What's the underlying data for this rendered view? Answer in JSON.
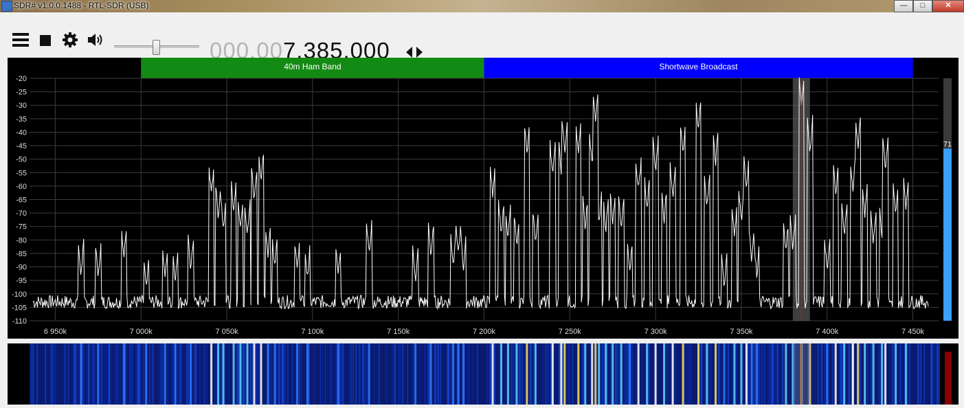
{
  "window": {
    "title": "SDR# v1.0.0.1488 - RTL-SDR (USB)",
    "minimize": "—",
    "maximize": "□",
    "close": "✕"
  },
  "toolbar": {
    "icons": [
      "menu-icon",
      "stop-icon",
      "gear-icon",
      "speaker-icon"
    ],
    "volume_fraction": 0.49,
    "frequency_dim": "000.00",
    "frequency_bright": "7.385.000"
  },
  "colors": {
    "ham_band": "#138a13",
    "broadcast_band": "#0000ff",
    "trace": "#ffffff",
    "vfo": "#ff0000",
    "level_bar": "#3aa0ff"
  },
  "bandplan": [
    {
      "label": "40m Ham Band",
      "start_khz": 7000,
      "end_khz": 7200
    },
    {
      "label": "Shortwave Broadcast",
      "start_khz": 7200,
      "end_khz": 7450
    }
  ],
  "level": {
    "label": "71",
    "value": 71,
    "max": 100
  },
  "chart_data": {
    "type": "line",
    "xlim": [
      6935,
      7465
    ],
    "ylim": [
      -110,
      -20
    ],
    "x_ticks": [
      6950,
      7000,
      7050,
      7100,
      7150,
      7200,
      7250,
      7300,
      7350,
      7400,
      7450
    ],
    "x_tick_labels": [
      "6 950k",
      "7 000k",
      "7 050k",
      "7 100k",
      "7 150k",
      "7 200k",
      "7 250k",
      "7 300k",
      "7 350k",
      "7 400k",
      "7 450k"
    ],
    "y_ticks": [
      -20,
      -25,
      -30,
      -35,
      -40,
      -45,
      -50,
      -55,
      -60,
      -65,
      -70,
      -75,
      -80,
      -85,
      -90,
      -95,
      -100,
      -105,
      -110
    ],
    "y_tick_labels": [
      "-20",
      "-25",
      "-30",
      "-35",
      "-40",
      "-45",
      "-50",
      "-55",
      "-60",
      "-65",
      "-70",
      "-75",
      "-80",
      "-85",
      "-90",
      "-95",
      "-100",
      "-105",
      "-110"
    ],
    "grid": true,
    "noise_floor_db": -103,
    "vfo_khz": 7385,
    "filter_khz": [
      7380,
      7390
    ],
    "peaks": [
      {
        "x": 6965,
        "y": -95
      },
      {
        "x": 6975,
        "y": -96
      },
      {
        "x": 6990,
        "y": -88
      },
      {
        "x": 7003,
        "y": -100
      },
      {
        "x": 7014,
        "y": -96
      },
      {
        "x": 7020,
        "y": -97
      },
      {
        "x": 7029,
        "y": -93
      },
      {
        "x": 7041,
        "y": -65
      },
      {
        "x": 7045,
        "y": -73
      },
      {
        "x": 7048,
        "y": -77
      },
      {
        "x": 7054,
        "y": -71
      },
      {
        "x": 7058,
        "y": -77
      },
      {
        "x": 7062,
        "y": -80
      },
      {
        "x": 7066,
        "y": -67
      },
      {
        "x": 7070,
        "y": -60
      },
      {
        "x": 7074,
        "y": -88
      },
      {
        "x": 7078,
        "y": -92
      },
      {
        "x": 7091,
        "y": -93
      },
      {
        "x": 7097,
        "y": -96
      },
      {
        "x": 7115,
        "y": -95
      },
      {
        "x": 7133,
        "y": -87
      },
      {
        "x": 7160,
        "y": -97
      },
      {
        "x": 7169,
        "y": -88
      },
      {
        "x": 7182,
        "y": -91
      },
      {
        "x": 7185,
        "y": -87
      },
      {
        "x": 7188,
        "y": -92
      },
      {
        "x": 7205,
        "y": -65
      },
      {
        "x": 7210,
        "y": -80
      },
      {
        "x": 7214,
        "y": -81
      },
      {
        "x": 7219,
        "y": -84
      },
      {
        "x": 7225,
        "y": -50
      },
      {
        "x": 7230,
        "y": -83
      },
      {
        "x": 7240,
        "y": -58
      },
      {
        "x": 7245,
        "y": -57
      },
      {
        "x": 7247,
        "y": -49
      },
      {
        "x": 7255,
        "y": -50
      },
      {
        "x": 7259,
        "y": -77
      },
      {
        "x": 7263,
        "y": -54
      },
      {
        "x": 7265,
        "y": -38
      },
      {
        "x": 7267,
        "y": -76
      },
      {
        "x": 7271,
        "y": -78
      },
      {
        "x": 7275,
        "y": -75
      },
      {
        "x": 7280,
        "y": -77
      },
      {
        "x": 7285,
        "y": -93
      },
      {
        "x": 7290,
        "y": -64
      },
      {
        "x": 7295,
        "y": -70
      },
      {
        "x": 7300,
        "y": -56
      },
      {
        "x": 7305,
        "y": -74
      },
      {
        "x": 7310,
        "y": -66
      },
      {
        "x": 7316,
        "y": -50
      },
      {
        "x": 7325,
        "y": -41
      },
      {
        "x": 7330,
        "y": -70
      },
      {
        "x": 7335,
        "y": -53
      },
      {
        "x": 7340,
        "y": -99
      },
      {
        "x": 7346,
        "y": -80
      },
      {
        "x": 7350,
        "y": -75
      },
      {
        "x": 7353,
        "y": -62
      },
      {
        "x": 7356,
        "y": -89
      },
      {
        "x": 7359,
        "y": -95
      },
      {
        "x": 7376,
        "y": -86
      },
      {
        "x": 7380,
        "y": -85
      },
      {
        "x": 7385,
        "y": -32
      },
      {
        "x": 7390,
        "y": -49
      },
      {
        "x": 7400,
        "y": -93
      },
      {
        "x": 7405,
        "y": -65
      },
      {
        "x": 7410,
        "y": -80
      },
      {
        "x": 7415,
        "y": -72
      },
      {
        "x": 7418,
        "y": -48
      },
      {
        "x": 7415,
        "y": -63
      },
      {
        "x": 7422,
        "y": -72
      },
      {
        "x": 7427,
        "y": -83
      },
      {
        "x": 7432,
        "y": -80
      },
      {
        "x": 7434,
        "y": -55
      },
      {
        "x": 7440,
        "y": -73
      },
      {
        "x": 7446,
        "y": -70
      }
    ]
  }
}
